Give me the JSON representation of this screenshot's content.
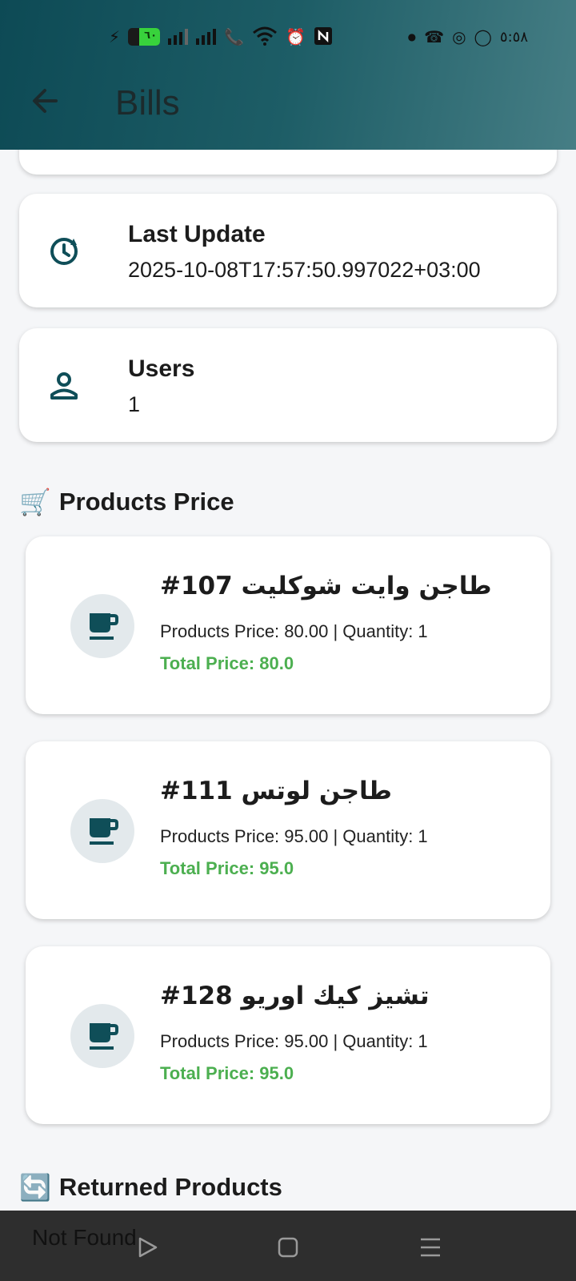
{
  "status_bar": {
    "battery_level": "٦٠",
    "time": "٥:٥٨",
    "colors": {
      "battery": "#38d23c"
    }
  },
  "header": {
    "back_icon": "arrow-left-icon",
    "title": "Bills"
  },
  "info_cards": [
    {
      "icon": "history-icon",
      "title": "Last Update",
      "value": "2025-10-08T17:57:50.997022+03:00"
    },
    {
      "icon": "person-icon",
      "title": "Users",
      "value": "1"
    }
  ],
  "sections": {
    "products_price": {
      "emoji": "🛒",
      "title": "Products Price"
    },
    "returned_products": {
      "emoji": "🔄",
      "title": "Returned Products"
    }
  },
  "products": [
    {
      "icon": "coffee-cup-icon",
      "title": "#107 طاجن وايت شوكليت",
      "detail": "Products Price: 80.00 | Quantity: 1",
      "total": "Total Price: 80.0"
    },
    {
      "icon": "coffee-cup-icon",
      "title": "#111 طاجن لوتس",
      "detail": "Products Price: 95.00 | Quantity: 1",
      "total": "Total Price: 95.0"
    },
    {
      "icon": "coffee-cup-icon",
      "title": "#128 تشيز كيك اوريو",
      "detail": "Products Price: 95.00 | Quantity: 1",
      "total": "Total Price: 95.0"
    }
  ],
  "overlay_text": "Not Found",
  "nav": {
    "back": "triangle-back-icon",
    "home": "square-home-icon",
    "recents": "menu-lines-icon"
  },
  "colors": {
    "primary": "#0d4a55",
    "total_green": "#4caf50",
    "accent_teal": "#0f4e58"
  }
}
